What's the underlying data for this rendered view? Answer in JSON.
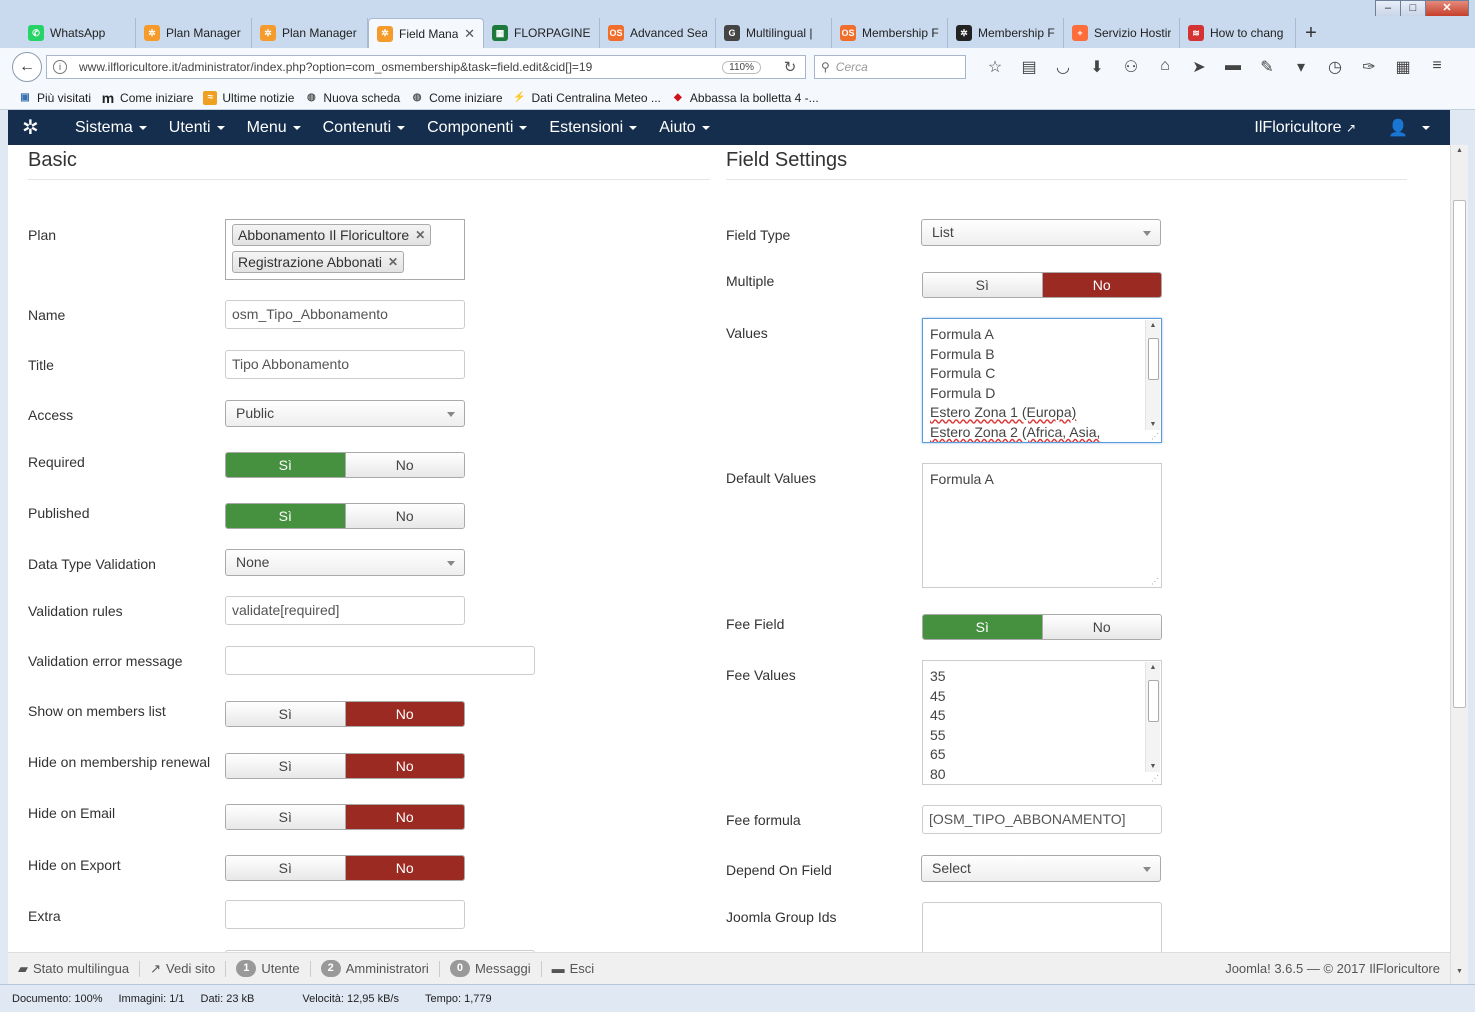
{
  "tabs": [
    {
      "label": "WhatsApp",
      "icon": "whatsapp-icon",
      "color": "#25d366"
    },
    {
      "label": "Plan Manager",
      "icon": "joomla-icon",
      "color": "#f49b2c"
    },
    {
      "label": "Plan Manager",
      "icon": "joomla-icon",
      "color": "#f49b2c"
    },
    {
      "label": "Field Mana",
      "icon": "joomla-icon",
      "color": "#f49b2c",
      "active": true
    },
    {
      "label": "FLORPAGINE",
      "icon": "sheet-icon",
      "color": "#1e7a3c"
    },
    {
      "label": "Advanced Sea",
      "icon": "os-icon",
      "color": "#f06d2a"
    },
    {
      "label": "Multilingual |",
      "icon": "google-icon",
      "color": "#444444"
    },
    {
      "label": "Membership F",
      "icon": "os-icon",
      "color": "#f06d2a"
    },
    {
      "label": "Membership F",
      "icon": "joomla-dark-icon",
      "color": "#222222"
    },
    {
      "label": "Servizio Hostir",
      "icon": "plus-icon",
      "color": "#ff6d3a"
    },
    {
      "label": "How to chang",
      "icon": "stripe-icon",
      "color": "#d33333"
    }
  ],
  "window_controls": {
    "minimize": "–",
    "maximize": "□",
    "close": "✕"
  },
  "browser": {
    "url": "www.ilfloricultore.it/administrator/index.php?option=com_osmembership&task=field.edit&cid[]=19",
    "zoom": "110%",
    "search_placeholder": "Cerca"
  },
  "bookmarks": [
    "Più visitati",
    "Come iniziare",
    "Ultime notizie",
    "Nuova scheda",
    "Come iniziare",
    "Dati Centralina Meteo ...",
    "Abbassa la bolletta 4 -..."
  ],
  "joomla_nav": {
    "menu": [
      "Sistema",
      "Utenti",
      "Menu",
      "Contenuti",
      "Componenti",
      "Estensioni",
      "Aiuto"
    ],
    "site_name": "IlFloricultore"
  },
  "basic": {
    "title": "Basic",
    "plan": {
      "label": "Plan",
      "chips": [
        "Abbonamento Il Floricultore",
        "Registrazione Abbonati"
      ]
    },
    "name": {
      "label": "Name",
      "value": "osm_Tipo_Abbonamento"
    },
    "title_field": {
      "label": "Title",
      "value": "Tipo Abbonamento"
    },
    "access": {
      "label": "Access",
      "value": "Public"
    },
    "required": {
      "label": "Required",
      "yes": "Sì",
      "no": "No",
      "selected": "yes"
    },
    "published": {
      "label": "Published",
      "yes": "Sì",
      "no": "No",
      "selected": "yes"
    },
    "data_type_validation": {
      "label": "Data Type Validation",
      "value": "None"
    },
    "validation_rules": {
      "label": "Validation rules",
      "value": "validate[required]"
    },
    "validation_error_message": {
      "label": "Validation error message",
      "value": ""
    },
    "show_on_members_list": {
      "label": "Show on members list",
      "yes": "Sì",
      "no": "No",
      "selected": "no"
    },
    "hide_on_membership_renewal": {
      "label": "Hide on membership renewal",
      "yes": "Sì",
      "no": "No",
      "selected": "no"
    },
    "hide_on_email": {
      "label": "Hide on Email",
      "yes": "Sì",
      "no": "No",
      "selected": "no"
    },
    "hide_on_export": {
      "label": "Hide on Export",
      "yes": "Sì",
      "no": "No",
      "selected": "no"
    },
    "extra": {
      "label": "Extra",
      "value": ""
    }
  },
  "field_settings": {
    "title": "Field Settings",
    "field_type": {
      "label": "Field Type",
      "value": "List"
    },
    "multiple": {
      "label": "Multiple",
      "yes": "Sì",
      "no": "No",
      "selected": "no"
    },
    "values": {
      "label": "Values",
      "lines": [
        "Formula A",
        "Formula B",
        "Formula C",
        "Formula D",
        "Estero Zona 1 (Europa)",
        "Estero Zona 2 (Africa, Asia,"
      ]
    },
    "default_values": {
      "label": "Default Values",
      "lines": [
        "Formula A"
      ]
    },
    "fee_field": {
      "label": "Fee Field",
      "yes": "Sì",
      "no": "No",
      "selected": "yes"
    },
    "fee_values": {
      "label": "Fee Values",
      "lines": [
        "35",
        "45",
        "45",
        "55",
        "65",
        "80"
      ]
    },
    "fee_formula": {
      "label": "Fee formula",
      "value": "[OSM_TIPO_ABBONAMENTO]"
    },
    "depend_on_field": {
      "label": "Depend On Field",
      "value": "Select"
    },
    "joomla_group_ids": {
      "label": "Joomla Group Ids",
      "value": ""
    }
  },
  "joomla_status": {
    "multilang": "Stato multilingua",
    "view_site": "Vedi sito",
    "users_count": "1",
    "users_label": "Utente",
    "admins_count": "2",
    "admins_label": "Amministratori",
    "messages_count": "0",
    "messages_label": "Messaggi",
    "logout": "Esci",
    "version": "Joomla! 3.6.5",
    "copyright": "— © 2017 IlFloricultore"
  },
  "firefox_status": {
    "document": "Documento: 100%",
    "images": "Immagini: 1/1",
    "data": "Dati: 23 kB",
    "speed": "Velocità: 12,95 kB/s",
    "time": "Tempo: 1,779"
  },
  "colors": {
    "joomla_nav": "#152e4d",
    "toggle_green": "#45913f",
    "toggle_red": "#9b2a22"
  }
}
